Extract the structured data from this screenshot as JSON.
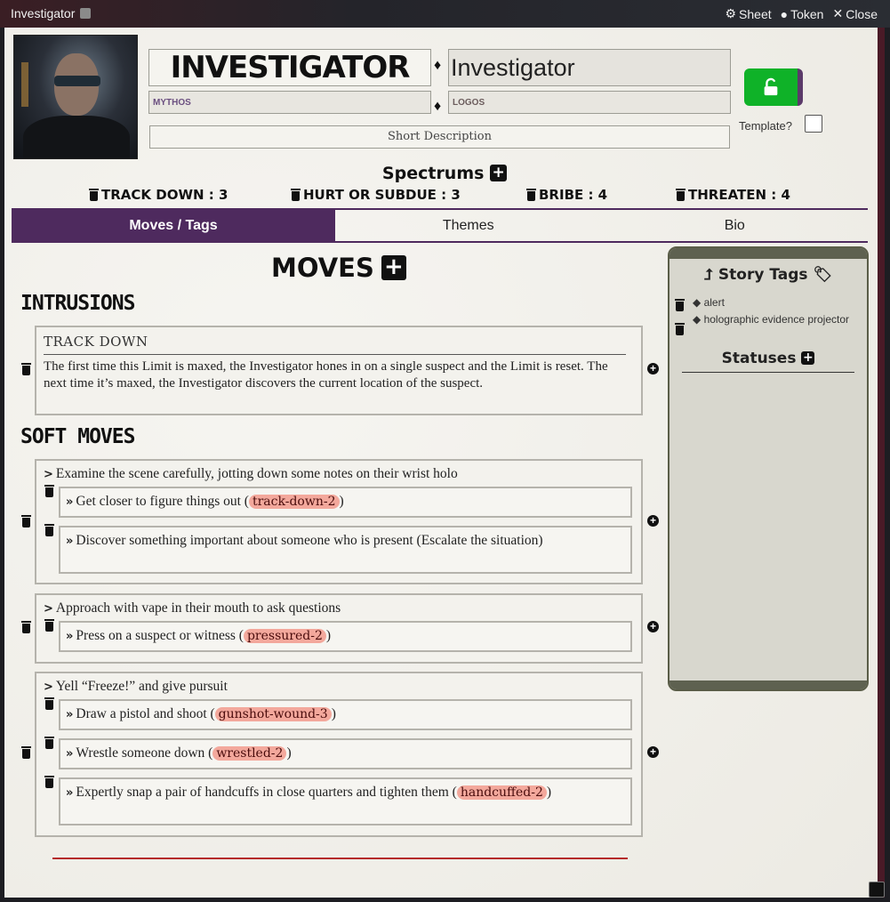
{
  "window": {
    "title": "Investigator",
    "sheet_label": "Sheet",
    "token_label": "Token",
    "close_label": "Close"
  },
  "header": {
    "name_display": "INVESTIGATOR",
    "name_value": "Investigator",
    "mythos_placeholder": "MYTHOS",
    "logos_placeholder": "LOGOS",
    "short_description_placeholder": "Short Description",
    "template_label": "Template?"
  },
  "spectrums": {
    "title": "Spectrums",
    "items": [
      {
        "label": "TRACK DOWN : 3"
      },
      {
        "label": "HURT OR SUBDUE : 3"
      },
      {
        "label": "BRIBE : 4"
      },
      {
        "label": "THREATEN : 4"
      }
    ]
  },
  "tabs": [
    {
      "label": "Moves / Tags",
      "active": true
    },
    {
      "label": "Themes",
      "active": false
    },
    {
      "label": "Bio",
      "active": false
    }
  ],
  "moves": {
    "title": "MOVES",
    "intrusions_title": "INTRUSIONS",
    "soft_moves_title": "SOFT MOVES",
    "limit": {
      "title": "TRACK DOWN",
      "text": "The first time this Limit is maxed, the Investigator hones in on a single suspect and the Limit is reset. The next time it’s maxed, the Investigator discovers the current location of the suspect."
    },
    "soft": [
      {
        "text": "Examine the scene carefully, jotting down some notes on their wrist holo",
        "subs": [
          {
            "text": "Get closer to figure things out (",
            "tag": "track-down-2",
            "after": ")"
          },
          {
            "text": "Discover something important about someone who is present (Escalate the situation)",
            "tag": "",
            "after": ""
          }
        ]
      },
      {
        "text": "Approach with vape in their mouth to ask questions",
        "subs": [
          {
            "text": "Press on a suspect or witness (",
            "tag": "pressured-2",
            "after": ")"
          }
        ]
      },
      {
        "text": "Yell “Freeze!” and give pursuit",
        "subs": [
          {
            "text": "Draw a pistol and shoot (",
            "tag": "gunshot-wound-3",
            "after": ")"
          },
          {
            "text": "Wrestle someone down (",
            "tag": "wrestled-2",
            "after": ")"
          },
          {
            "text": "Expertly snap a pair of handcuffs in close quarters and tighten them (",
            "tag": "handcuffed-2",
            "after": ")"
          }
        ]
      }
    ]
  },
  "story_panel": {
    "title": "Story Tags",
    "tags": [
      "alert",
      "holographic evidence projector"
    ],
    "statuses_title": "Statuses"
  },
  "colors": {
    "tab_active": "#4e2a5e",
    "lock_button": "#0fb228",
    "tag_bg": "#f3a89c",
    "panel_band": "#5e6150",
    "accent_rule": "#b52a2a"
  }
}
